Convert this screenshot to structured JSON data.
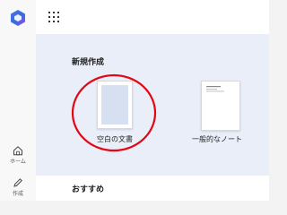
{
  "rail": {
    "home_label": "ホーム",
    "create_label": "作成"
  },
  "main": {
    "new_section_title": "新規作成",
    "recommend_title": "おすすめ",
    "templates": [
      {
        "label": "空白の文書"
      },
      {
        "label": "一般的なノート"
      }
    ]
  },
  "colors": {
    "accent": "#0f6cbd",
    "annotation": "#e30613",
    "main_bg": "#e9eef8"
  }
}
